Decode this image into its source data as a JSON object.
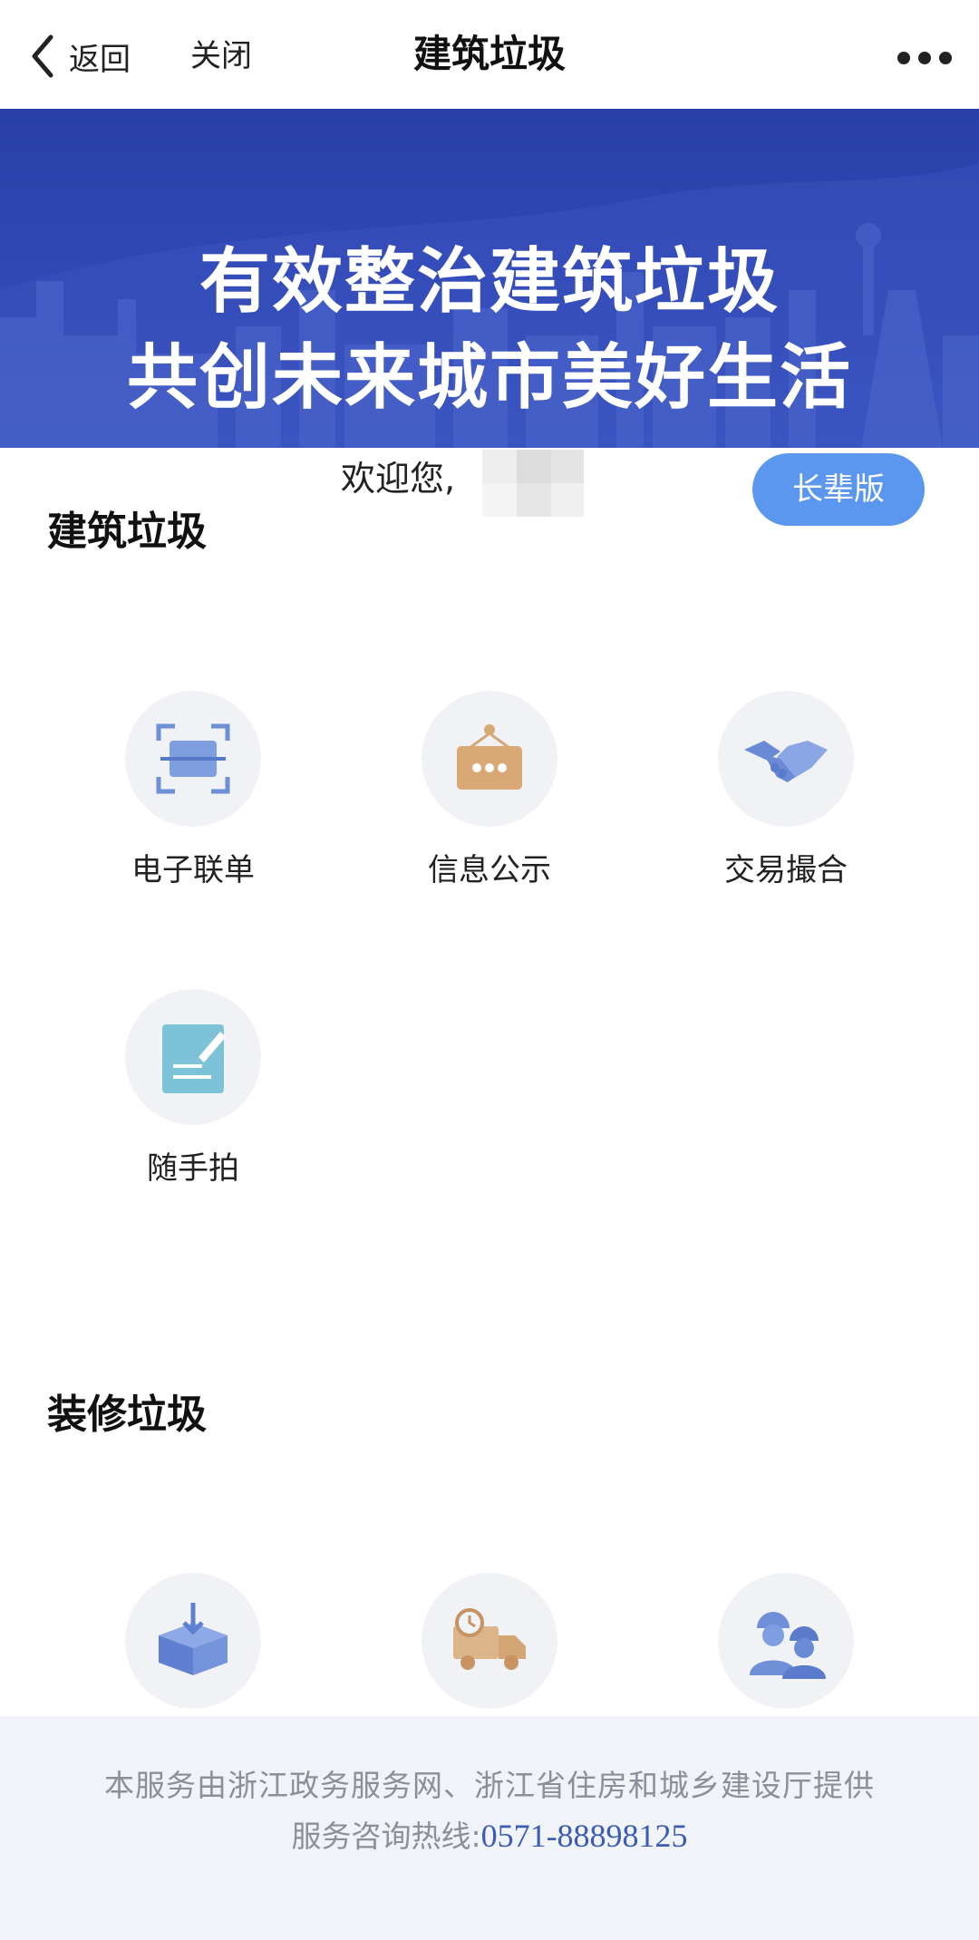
{
  "nav": {
    "back_label": "返回",
    "close_label": "关闭",
    "title": "建筑垃圾"
  },
  "banner": {
    "line1": "有效整治建筑垃圾",
    "line2": "共创未来城市美好生活"
  },
  "welcome": {
    "text": "欢迎您,",
    "elder_button": "长辈版"
  },
  "sections": [
    {
      "title": "建筑垃圾",
      "items": [
        {
          "label": "电子联单",
          "icon": "scan-icon"
        },
        {
          "label": "信息公示",
          "icon": "notice-board-icon"
        },
        {
          "label": "交易撮合",
          "icon": "handshake-icon"
        },
        {
          "label": "随手拍",
          "icon": "edit-note-icon"
        }
      ]
    },
    {
      "title": "装修垃圾",
      "items": [
        {
          "label": "",
          "icon": "inbox-download-icon"
        },
        {
          "label": "",
          "icon": "truck-clock-icon"
        },
        {
          "label": "",
          "icon": "workers-icon"
        }
      ]
    }
  ],
  "footer": {
    "line1": "本服务由浙江政务服务网、浙江省住房和城乡建设厅提供",
    "hotline_label": "服务咨询热线:",
    "hotline_number": "0571-88898125"
  },
  "colors": {
    "banner": "#3048b6",
    "accent_button": "#5b97ee",
    "footer_bg": "#f0f3f8",
    "phone": "#3c5bb5"
  }
}
